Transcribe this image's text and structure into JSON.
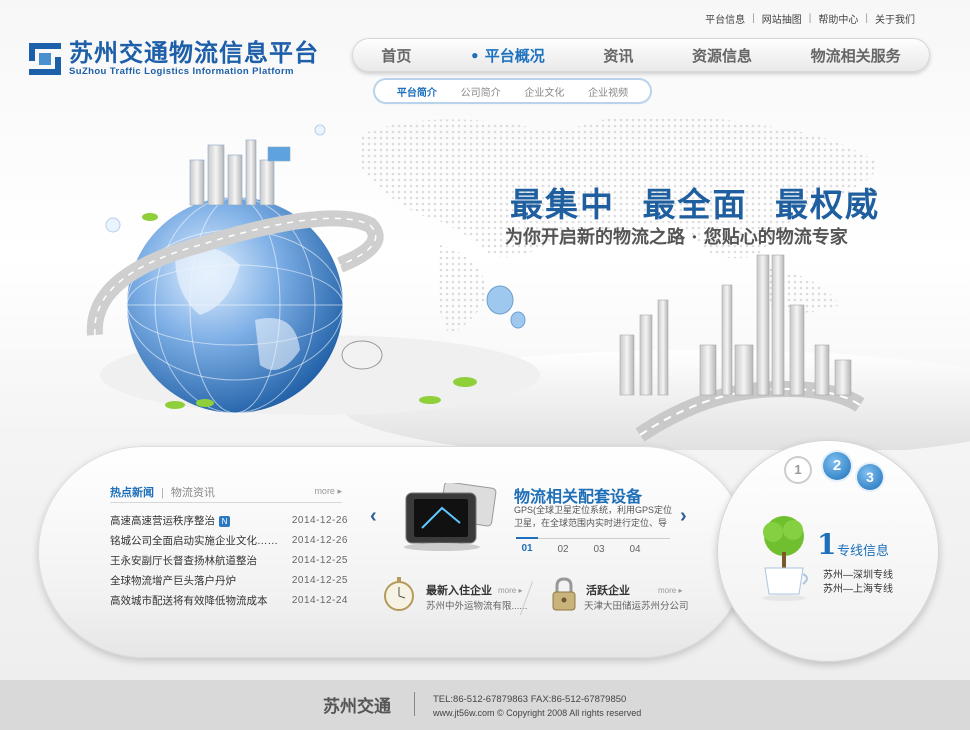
{
  "top_links": [
    "平台信息",
    "网站抽图",
    "帮助中心",
    "关于我们"
  ],
  "logo": {
    "title": "苏州交通物流信息平台",
    "subtitle": "SuZhou Traffic Logistics Information Platform"
  },
  "main_nav": [
    {
      "label": "首页"
    },
    {
      "label": "• 平台概况"
    },
    {
      "label": "资讯"
    },
    {
      "label": "资源信息"
    },
    {
      "label": "物流相关服务"
    }
  ],
  "sub_nav": [
    "平台简介",
    "公司简介",
    "企业文化",
    "企业视频"
  ],
  "banner": {
    "slogan_main": "最集中 最全面 最权威",
    "slogan_sub": "为你开启新的物流之路 · 您贴心的物流专家"
  },
  "news": {
    "tab_active": "热点新闻",
    "tab_other": "物流资讯",
    "more": "more",
    "new_badge": "N",
    "items": [
      {
        "title": "高速高速营运秩序整治",
        "date": "2014-12-26"
      },
      {
        "title": "铭城公司全面启动实施企业文化……",
        "date": "2014-12-26"
      },
      {
        "title": "王永安副厅长督查扬林航道整治",
        "date": "2014-12-25"
      },
      {
        "title": "全球物流增产巨头落户丹炉",
        "date": "2014-12-25"
      },
      {
        "title": "高效城市配送将有效降低物流成本",
        "date": "2014-12-24"
      }
    ]
  },
  "equipment": {
    "title": "物流相关配套设备",
    "desc": "GPS(全球卫星定位系统，利用GPS定位卫星，在全球范围内实时进行定位、导航",
    "pages": [
      "01",
      "02",
      "03",
      "04"
    ],
    "prev": "‹",
    "next": "›"
  },
  "new_enterprise": {
    "label": "最新入住企业",
    "more": "more",
    "name": "苏州中外运物流有限......"
  },
  "active_enterprise": {
    "label": "活跃企业",
    "more": "more",
    "name": "天津大田储运苏州分公司"
  },
  "lines": {
    "steps": [
      "1",
      "2",
      "3"
    ],
    "big_number": "1",
    "title": "专线信息",
    "routes": [
      "苏州—深圳专线",
      "苏州—上海专线"
    ]
  },
  "footer": {
    "brand": "苏州交通",
    "tel": "TEL:86-512-67879863    FAX:86-512-67879850",
    "copyright": "www.jt56w.com © Copyright 2008 All rights reserved"
  },
  "colors": {
    "brand_blue": "#1d5fa8",
    "accent_blue": "#1d72c0"
  }
}
